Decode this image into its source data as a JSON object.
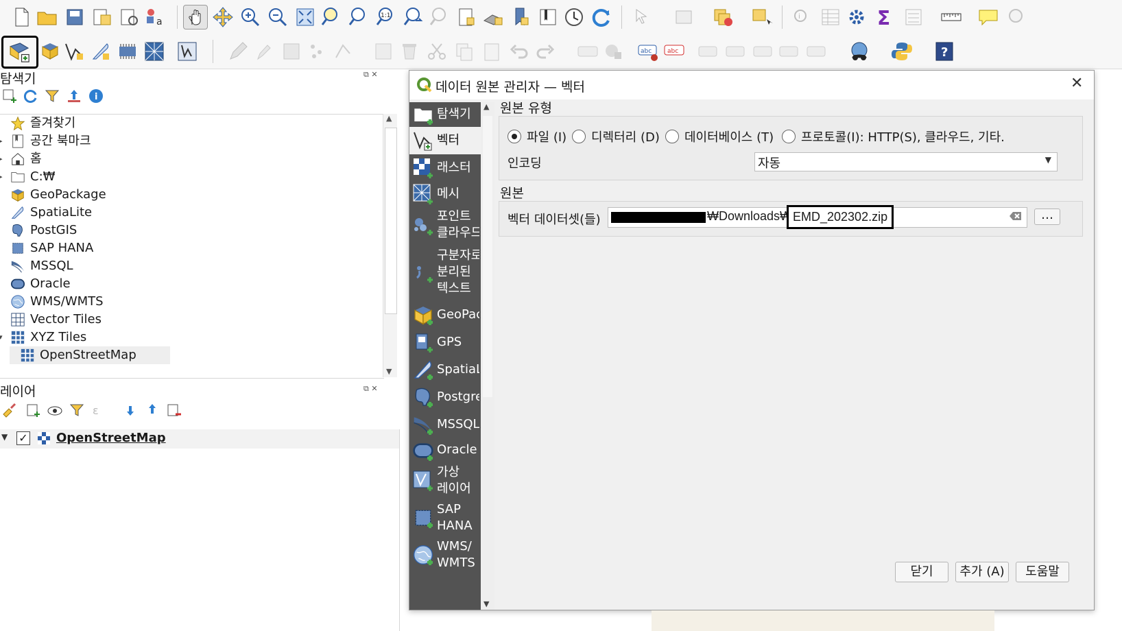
{
  "browser_panel": {
    "title": "탐색기",
    "items": [
      {
        "label": "즐겨찾기",
        "icon": "star-icon",
        "expander": ""
      },
      {
        "label": "공간 북마크",
        "icon": "bookmark-icon",
        "expander": "▸"
      },
      {
        "label": "홈",
        "icon": "home-icon",
        "expander": "▸"
      },
      {
        "label": "C:₩",
        "icon": "folder-icon",
        "expander": "▸"
      },
      {
        "label": "GeoPackage",
        "icon": "geopackage-icon",
        "expander": ""
      },
      {
        "label": "SpatiaLite",
        "icon": "spatialite-icon",
        "expander": ""
      },
      {
        "label": "PostGIS",
        "icon": "postgis-icon",
        "expander": ""
      },
      {
        "label": "SAP HANA",
        "icon": "saphana-icon",
        "expander": ""
      },
      {
        "label": "MSSQL",
        "icon": "mssql-icon",
        "expander": ""
      },
      {
        "label": "Oracle",
        "icon": "oracle-icon",
        "expander": ""
      },
      {
        "label": "WMS/WMTS",
        "icon": "wms-icon",
        "expander": ""
      },
      {
        "label": "Vector Tiles",
        "icon": "vector-tiles-icon",
        "expander": ""
      },
      {
        "label": "XYZ Tiles",
        "icon": "xyz-tiles-icon",
        "expander": "▾"
      },
      {
        "label": "OpenStreetMap",
        "icon": "xyz-tiles-icon",
        "expander": ""
      }
    ]
  },
  "layers_panel": {
    "title": "레이어",
    "layer_name": "OpenStreetMap"
  },
  "dialog": {
    "title": "데이터 원본 관리자 — 벡터",
    "nav": [
      {
        "label": "탐색기",
        "icon": "folder-icon"
      },
      {
        "label": "벡터",
        "icon": "vector-icon"
      },
      {
        "label": "래스터",
        "icon": "raster-icon"
      },
      {
        "label": "메시",
        "icon": "mesh-icon"
      },
      {
        "label": "포인트\n클라우드",
        "icon": "point-cloud-icon"
      },
      {
        "label": "구분자로\n분리된\n텍스트",
        "icon": "delimited-text-icon"
      },
      {
        "label": "GeoPackage",
        "icon": "geopackage-icon"
      },
      {
        "label": "GPS",
        "icon": "gps-icon"
      },
      {
        "label": "SpatiaLite",
        "icon": "spatialite-icon"
      },
      {
        "label": "PostgreSQL",
        "icon": "postgis-icon"
      },
      {
        "label": "MSSQL",
        "icon": "mssql-icon"
      },
      {
        "label": "Oracle",
        "icon": "oracle-icon"
      },
      {
        "label": "가상\n레이어",
        "icon": "virtual-layer-icon"
      },
      {
        "label": "SAP\nHANA",
        "icon": "saphana-icon"
      },
      {
        "label": "WMS/\nWMTS",
        "icon": "wms-icon"
      }
    ],
    "source_type": {
      "heading": "원본 유형",
      "options": [
        "파일 (I)",
        "디렉터리 (D)",
        "데이터베이스 (T)",
        "프로토콜(I): HTTP(S), 클라우드, 기타."
      ],
      "selected": "파일 (I)",
      "encoding_label": "인코딩",
      "encoding_value": "자동"
    },
    "source": {
      "heading": "원본",
      "dataset_label": "벡터 데이터셋(들)",
      "path_middle": "₩Downloads₩",
      "path_file": "EMD_202302.zip",
      "browse_label": "…"
    },
    "buttons": {
      "close": "닫기",
      "add": "추가 (A)",
      "help": "도움말"
    }
  },
  "colors": {
    "nav_bg": "#535353",
    "dialog_bg": "#f0f0f0",
    "qgis_green": "#589632",
    "highlight_box": "#000000"
  }
}
